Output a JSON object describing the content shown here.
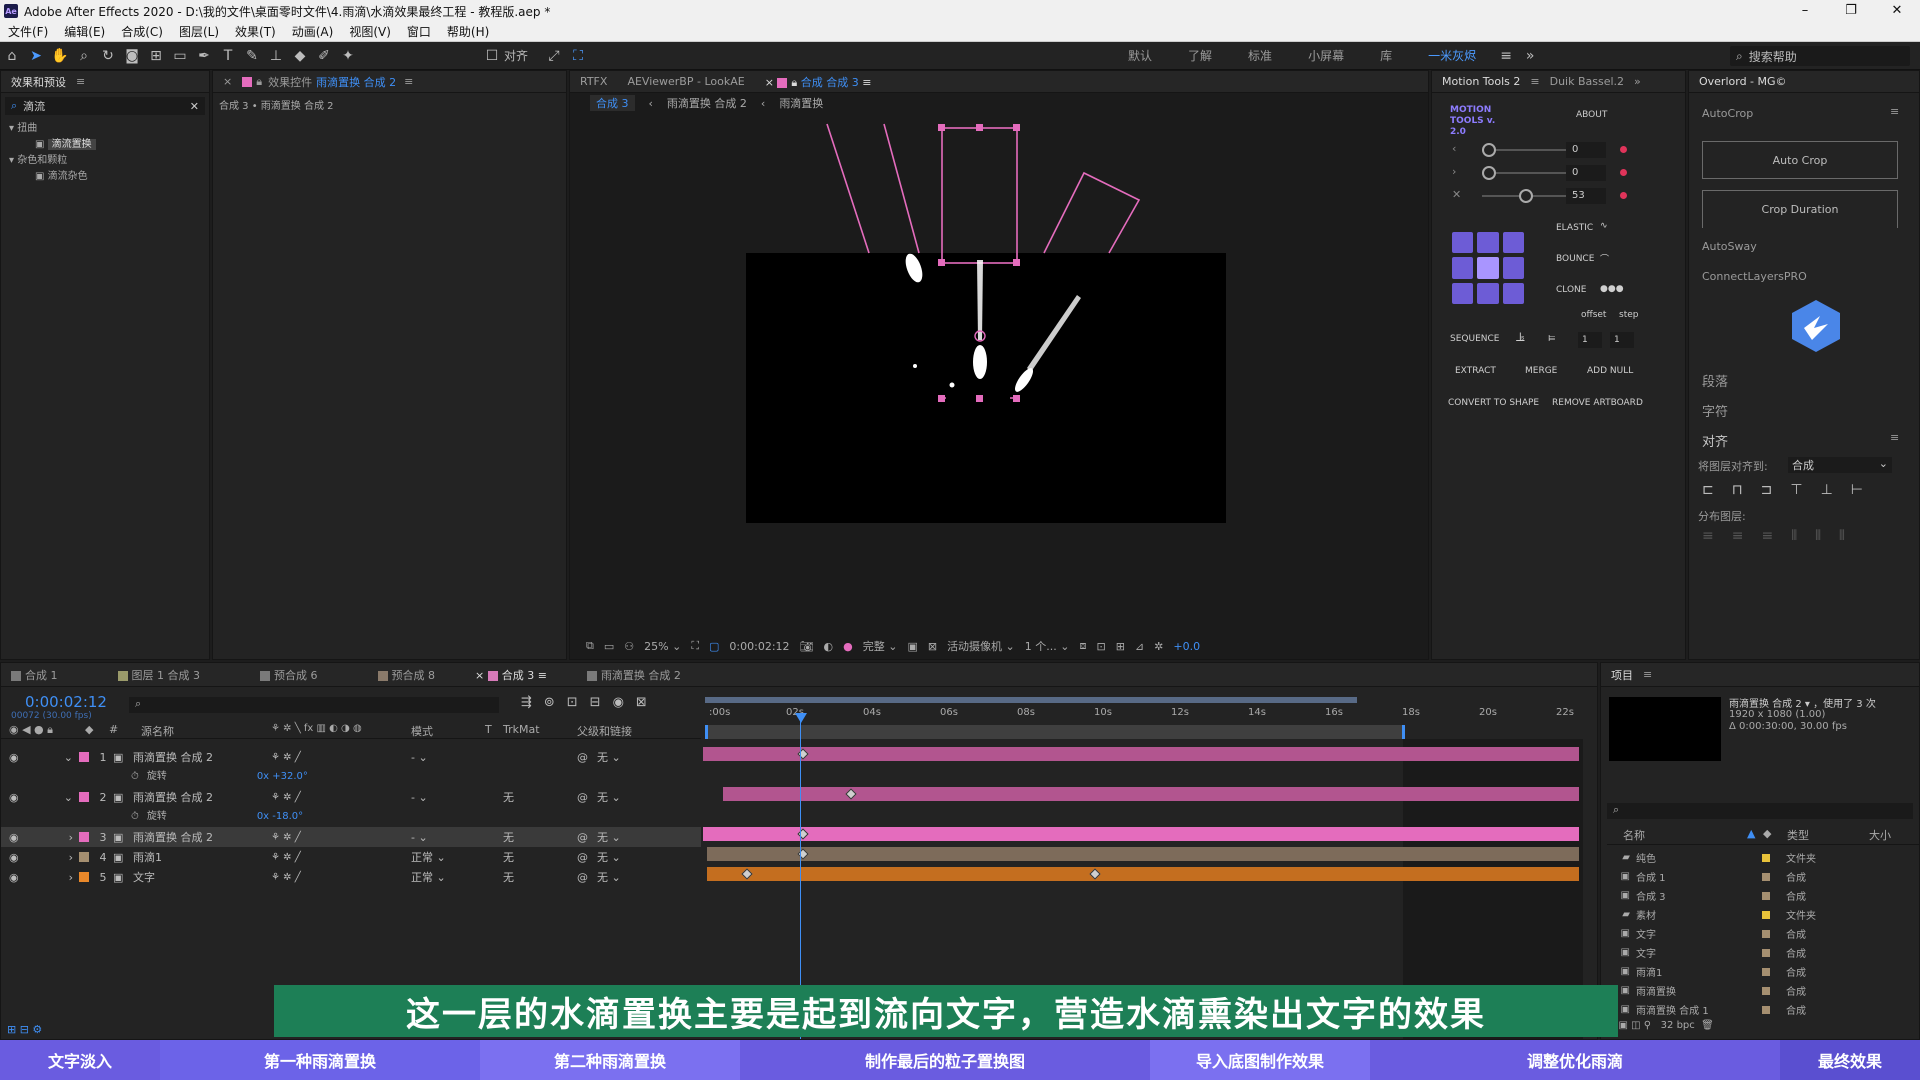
{
  "app": {
    "title": "Adobe After Effects 2020 - D:\\我的文件\\桌面零时文件\\4.雨滴\\水滴效果最终工程 - 教程版.aep *",
    "logo": "Ae",
    "menu": [
      "文件(F)",
      "编辑(E)",
      "合成(C)",
      "图层(L)",
      "效果(T)",
      "动画(A)",
      "视图(V)",
      "窗口",
      "帮助(H)"
    ]
  },
  "toolbar": {
    "snap_label": "对齐",
    "workspaces": [
      "默认",
      "了解",
      "标准",
      "小屏幕",
      "库",
      "一米灰烬"
    ],
    "active_workspace": "一米灰烬",
    "search_placeholder": "搜索帮助"
  },
  "effects_panel": {
    "title": "效果和预设",
    "search_value": "滴流",
    "tree": [
      {
        "label": "扭曲",
        "level": 0
      },
      {
        "label": "滴流置换",
        "level": 1,
        "highlight": true
      },
      {
        "label": "杂色和颗粒",
        "level": 0
      },
      {
        "label": "滴流杂色",
        "level": 1
      }
    ]
  },
  "effect_controls": {
    "tab_prefix": "效果控件",
    "tab_target": "雨滴置换 合成 2",
    "breadcrumb": "合成 3 • 雨滴置换 合成 2"
  },
  "composition_panel": {
    "tabs": [
      "RTFX",
      "AEViewerBP - LookAE",
      "合成 合成 3"
    ],
    "breadcrumbs": [
      "合成 3",
      "雨滴置换 合成 2",
      "雨滴置换"
    ],
    "zoom": "25%",
    "timecode": "0:00:02:12",
    "resolution": "完整",
    "camera": "活动摄像机",
    "views": "1 个...",
    "exposure": "+0.0"
  },
  "motion_tools": {
    "tabs": [
      "Motion Tools 2",
      "Duik Bassel.2"
    ],
    "logo": "MOTION TOOLS v. 2.0",
    "about": "ABOUT",
    "sliders": [
      {
        "value": "0",
        "knob": 0.0
      },
      {
        "value": "0",
        "knob": 0.0
      },
      {
        "value": "53",
        "knob": 0.53
      }
    ],
    "labels": {
      "elastic": "ELASTIC",
      "bounce": "BOUNCE",
      "clone": "CLONE",
      "offset": "offset",
      "step": "step",
      "sequence": "SEQUENCE",
      "seq_a": "1",
      "seq_b": "1",
      "extract": "EXTRACT",
      "merge": "MERGE",
      "add_null": "ADD NULL",
      "convert": "CONVERT TO SHAPE",
      "remove_artboard": "REMOVE ARTBOARD"
    }
  },
  "overlord": {
    "tab": "Overlord - MG©",
    "autocrop": "AutoCrop",
    "auto_crop_button": "Auto Crop",
    "crop_duration_button": "Crop Duration",
    "autosway": "AutoSway",
    "connect_layers": "ConnectLayersPRO",
    "paragraph": "段落",
    "character": "字符",
    "align": "对齐",
    "align_to_label": "将图层对齐到:",
    "align_to_value": "合成",
    "distribute": "分布图层:"
  },
  "timeline": {
    "tabs": [
      "合成 1",
      "图层 1 合成 3",
      "预合成 6",
      "预合成 8",
      "合成 3",
      "雨滴置换 合成 2"
    ],
    "active_tab": "合成 3",
    "tab_colors": [
      "#7a7a7a",
      "#9a9a6a",
      "#7a7a7a",
      "#8a7a6a",
      "#d67ab8",
      "#7a7a7a"
    ],
    "timecode": "0:00:02:12",
    "frame_info": "00072 (30.00 fps)",
    "ruler": [
      ":00s",
      "02s",
      "04s",
      "06s",
      "08s",
      "10s",
      "12s",
      "14s",
      "16s",
      "18s",
      "20s",
      "22s"
    ],
    "headers": {
      "source": "源名称",
      "mode": "模式",
      "t": "T",
      "trkmat": "TrkMat",
      "parent": "父级和链接"
    },
    "layers": [
      {
        "num": "1",
        "name": "雨滴置换 合成 2",
        "color": "#e46cbd",
        "mode": "-",
        "trk": "",
        "parent": "无",
        "sub_label": "旋转",
        "sub_value": "0x +32.0°"
      },
      {
        "num": "2",
        "name": "雨滴置换 合成 2",
        "color": "#e46cbd",
        "mode": "-",
        "trk": "无",
        "parent": "无",
        "sub_label": "旋转",
        "sub_value": "0x -18.0°"
      },
      {
        "num": "3",
        "name": "雨滴置换 合成 2",
        "color": "#e46cbd",
        "mode": "-",
        "trk": "无",
        "parent": "无"
      },
      {
        "num": "4",
        "name": "雨滴1",
        "color": "#a58f70",
        "mode": "正常",
        "trk": "无",
        "parent": "无"
      },
      {
        "num": "5",
        "name": "文字",
        "color": "#e9882a",
        "mode": "正常",
        "trk": "无",
        "parent": "无"
      }
    ]
  },
  "project": {
    "title": "项目",
    "item_name": "雨滴置换 合成 2",
    "used": "，使用了 3 次",
    "dims": "1920 x 1080 (1.00)",
    "duration": "Δ 0:00:30:00, 30.00 fps",
    "headers": {
      "name": "名称",
      "type": "类型",
      "size": "大小"
    },
    "items": [
      {
        "name": "纯色",
        "type": "文件夹",
        "color": "#e8c23a"
      },
      {
        "name": "合成 1",
        "type": "合成",
        "color": "#a58f70"
      },
      {
        "name": "合成 3",
        "type": "合成",
        "color": "#a58f70"
      },
      {
        "name": "素材",
        "type": "文件夹",
        "color": "#e8c23a"
      },
      {
        "name": "文字",
        "type": "合成",
        "color": "#a58f70"
      },
      {
        "name": "文字",
        "type": "合成",
        "color": "#a58f70"
      },
      {
        "name": "雨滴1",
        "type": "合成",
        "color": "#a58f70"
      },
      {
        "name": "雨滴置换",
        "type": "合成",
        "color": "#a58f70"
      },
      {
        "name": "雨滴置换 合成 1",
        "type": "合成",
        "color": "#a58f70"
      }
    ],
    "bpc": "32 bpc"
  },
  "subtitle": "这一层的水滴置换主要是起到流向文字，营造水滴熏染出文字的效果",
  "chapters": [
    {
      "label": "文字淡入",
      "color": "#6a5ce0"
    },
    {
      "label": "第一种雨滴置换",
      "color": "#6c63e8"
    },
    {
      "label": "第二种雨滴置换",
      "color": "#7b70f0"
    },
    {
      "label": "制作最后的粒子置换图",
      "color": "#6a5ce0"
    },
    {
      "label": "导入底图制作效果",
      "color": "#7b70f0"
    },
    {
      "label": "调整优化雨滴",
      "color": "#6a5ce0"
    },
    {
      "label": "最终效果",
      "color": "#5a4fd0"
    }
  ]
}
